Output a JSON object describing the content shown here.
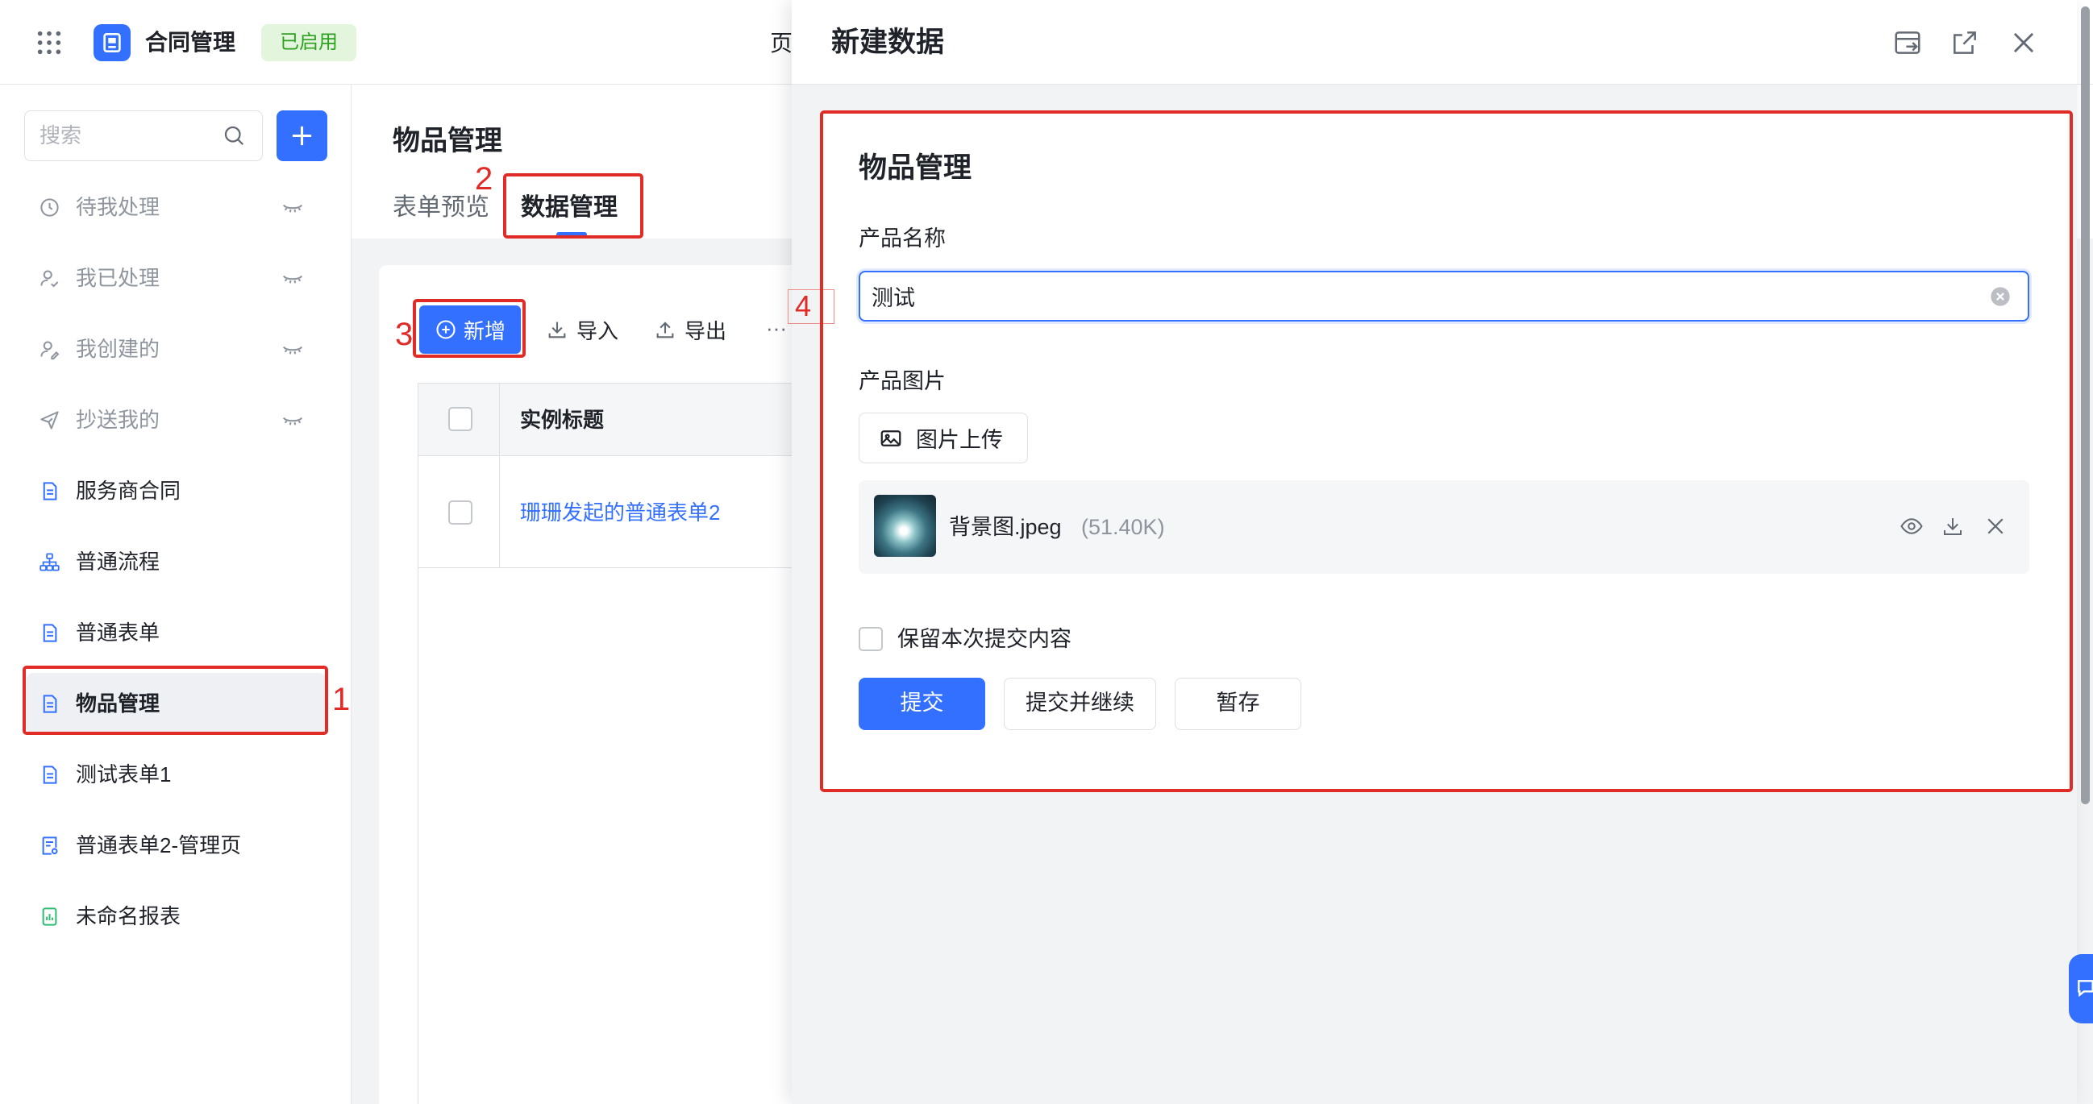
{
  "topbar": {
    "app_name": "合同管理",
    "status_badge": "已启用",
    "page_hint": "页"
  },
  "sidebar": {
    "search_placeholder": "搜索",
    "items": [
      {
        "label": "待我处理",
        "icon": "clock-icon",
        "visibility_icon": "eye-closed-icon",
        "muted": true
      },
      {
        "label": "我已处理",
        "icon": "user-check-icon",
        "visibility_icon": "eye-closed-icon",
        "muted": true
      },
      {
        "label": "我创建的",
        "icon": "user-edit-icon",
        "visibility_icon": "eye-closed-icon",
        "muted": true
      },
      {
        "label": "抄送我的",
        "icon": "send-icon",
        "visibility_icon": "eye-closed-icon",
        "muted": true
      },
      {
        "label": "服务商合同",
        "icon": "form-icon"
      },
      {
        "label": "普通流程",
        "icon": "flow-icon"
      },
      {
        "label": "普通表单",
        "icon": "form-icon"
      },
      {
        "label": "物品管理",
        "icon": "form-icon",
        "active": true
      },
      {
        "label": "测试表单1",
        "icon": "form-icon"
      },
      {
        "label": "普通表单2-管理页",
        "icon": "admin-page-icon"
      },
      {
        "label": "未命名报表",
        "icon": "report-icon"
      }
    ]
  },
  "main": {
    "title": "物品管理",
    "tabs": [
      {
        "label": "表单预览",
        "active": false
      },
      {
        "label": "数据管理",
        "active": true
      }
    ],
    "toolbar": {
      "add_label": "新增",
      "import_label": "导入",
      "export_label": "导出",
      "more_label": "···"
    },
    "table": {
      "columns": [
        "实例标题"
      ],
      "rows": [
        {
          "title": "珊珊发起的普通表单2"
        }
      ]
    }
  },
  "drawer": {
    "title": "新建数据",
    "header_icons": [
      "window-mode-icon",
      "open-in-new-icon",
      "close-icon"
    ],
    "form": {
      "title": "物品管理",
      "product_name": {
        "label": "产品名称",
        "value": "测试"
      },
      "product_image": {
        "label": "产品图片",
        "upload_label": "图片上传",
        "file": {
          "name": "背景图.jpeg",
          "size": "(51.40K)"
        }
      },
      "keep_content": {
        "label": "保留本次提交内容",
        "checked": false
      },
      "actions": {
        "submit": "提交",
        "submit_continue": "提交并继续",
        "save_draft": "暂存"
      }
    }
  },
  "annotations": {
    "step_1": "1",
    "step_2": "2",
    "step_3": "3",
    "step_4": "4"
  },
  "colors": {
    "primary": "#3370ff",
    "annotation": "#e02b27",
    "text": "#1f2329",
    "muted_text": "#8f959e",
    "badge_text": "#2ea121",
    "badge_bg": "#e3f5dc",
    "report_icon": "#2ebd72",
    "page_bg": "#f2f3f5"
  }
}
